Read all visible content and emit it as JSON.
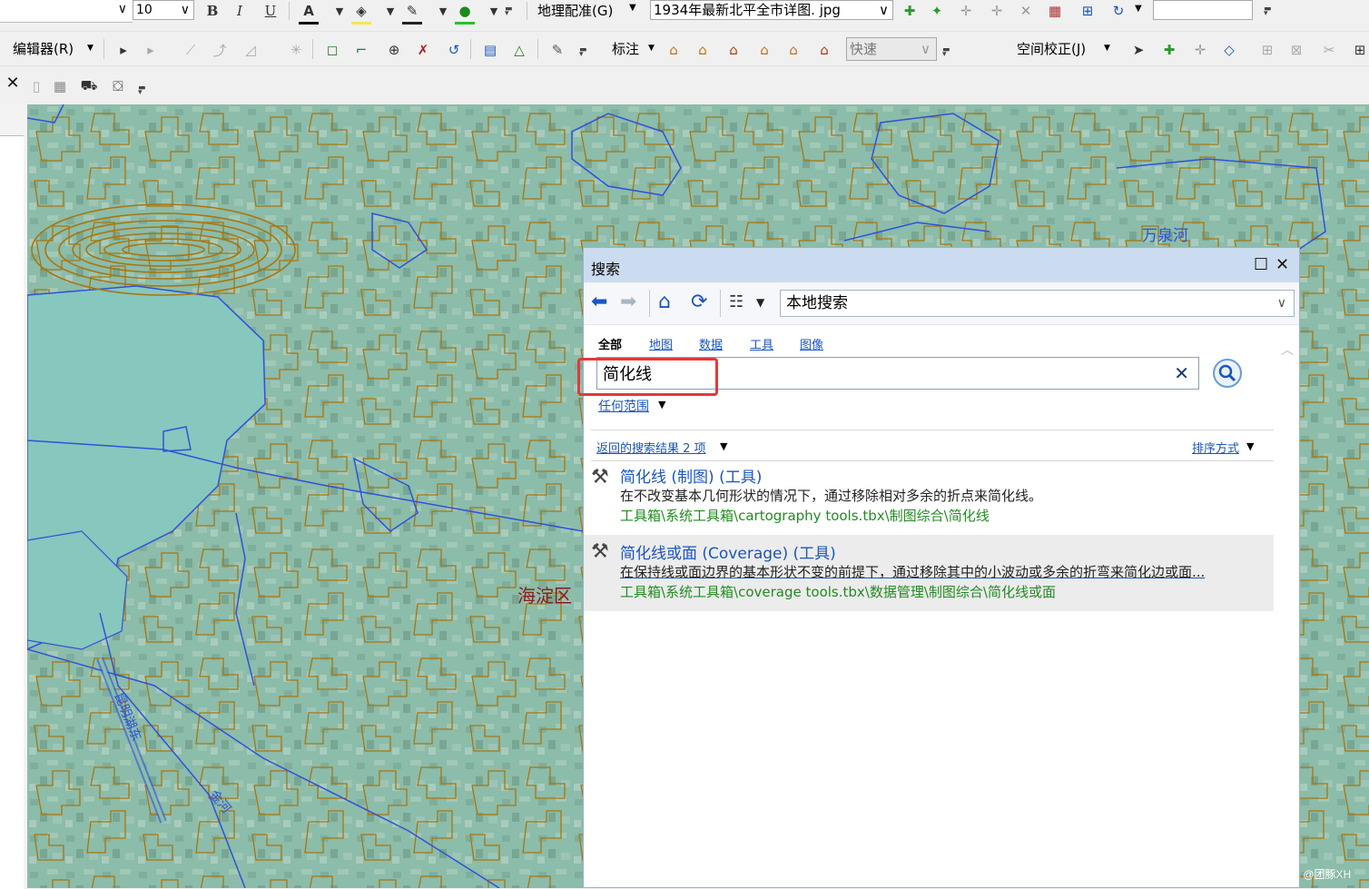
{
  "toolbar1": {
    "font_size": "10",
    "bold": "B",
    "italic": "I",
    "underline": "U",
    "georef_menu": "地理配准(G)",
    "layer_combo": "1934年最新北平全市详图. jpg"
  },
  "toolbar2": {
    "editor_menu": "编辑器(R)",
    "label_menu": "标注",
    "quick_combo": "快速",
    "spatial_adjust_menu": "空间校正(J)"
  },
  "map": {
    "district_label": "海淀区",
    "river_label": "万泉河",
    "canal_label": "昆明湖东",
    "small_label": "金河",
    "watermark": "CSDN @团豚XH"
  },
  "search_panel": {
    "title": "搜索",
    "scope": "本地搜索",
    "tabs": [
      "全部",
      "地图",
      "数据",
      "工具",
      "图像"
    ],
    "query": "简化线",
    "range": "任何范围",
    "result_count": "返回的搜索结果 2 项",
    "sort": "排序方式",
    "results": [
      {
        "title": "简化线 (制图) (工具)",
        "desc": "在不改变基本几何形状的情况下，通过移除相对多余的折点来简化线。",
        "path": "工具箱\\系统工具箱\\cartography tools.tbx\\制图综合\\简化线"
      },
      {
        "title": "简化线或面 (Coverage) (工具)",
        "desc": "在保持线或面边界的基本形状不变的前提下，通过移除其中的小波动或多余的折弯来简化边或面...",
        "path": "工具箱\\系统工具箱\\coverage tools.tbx\\数据管理\\制图综合\\简化线或面"
      }
    ]
  },
  "colors": {
    "contour": "#a8760e",
    "water_line": "#2f52d8",
    "map_base": "#8fc0b0",
    "lake": "#84c6bd",
    "highlight": "#e03a3a",
    "link": "#1a55c0",
    "path_green": "#228b22"
  }
}
